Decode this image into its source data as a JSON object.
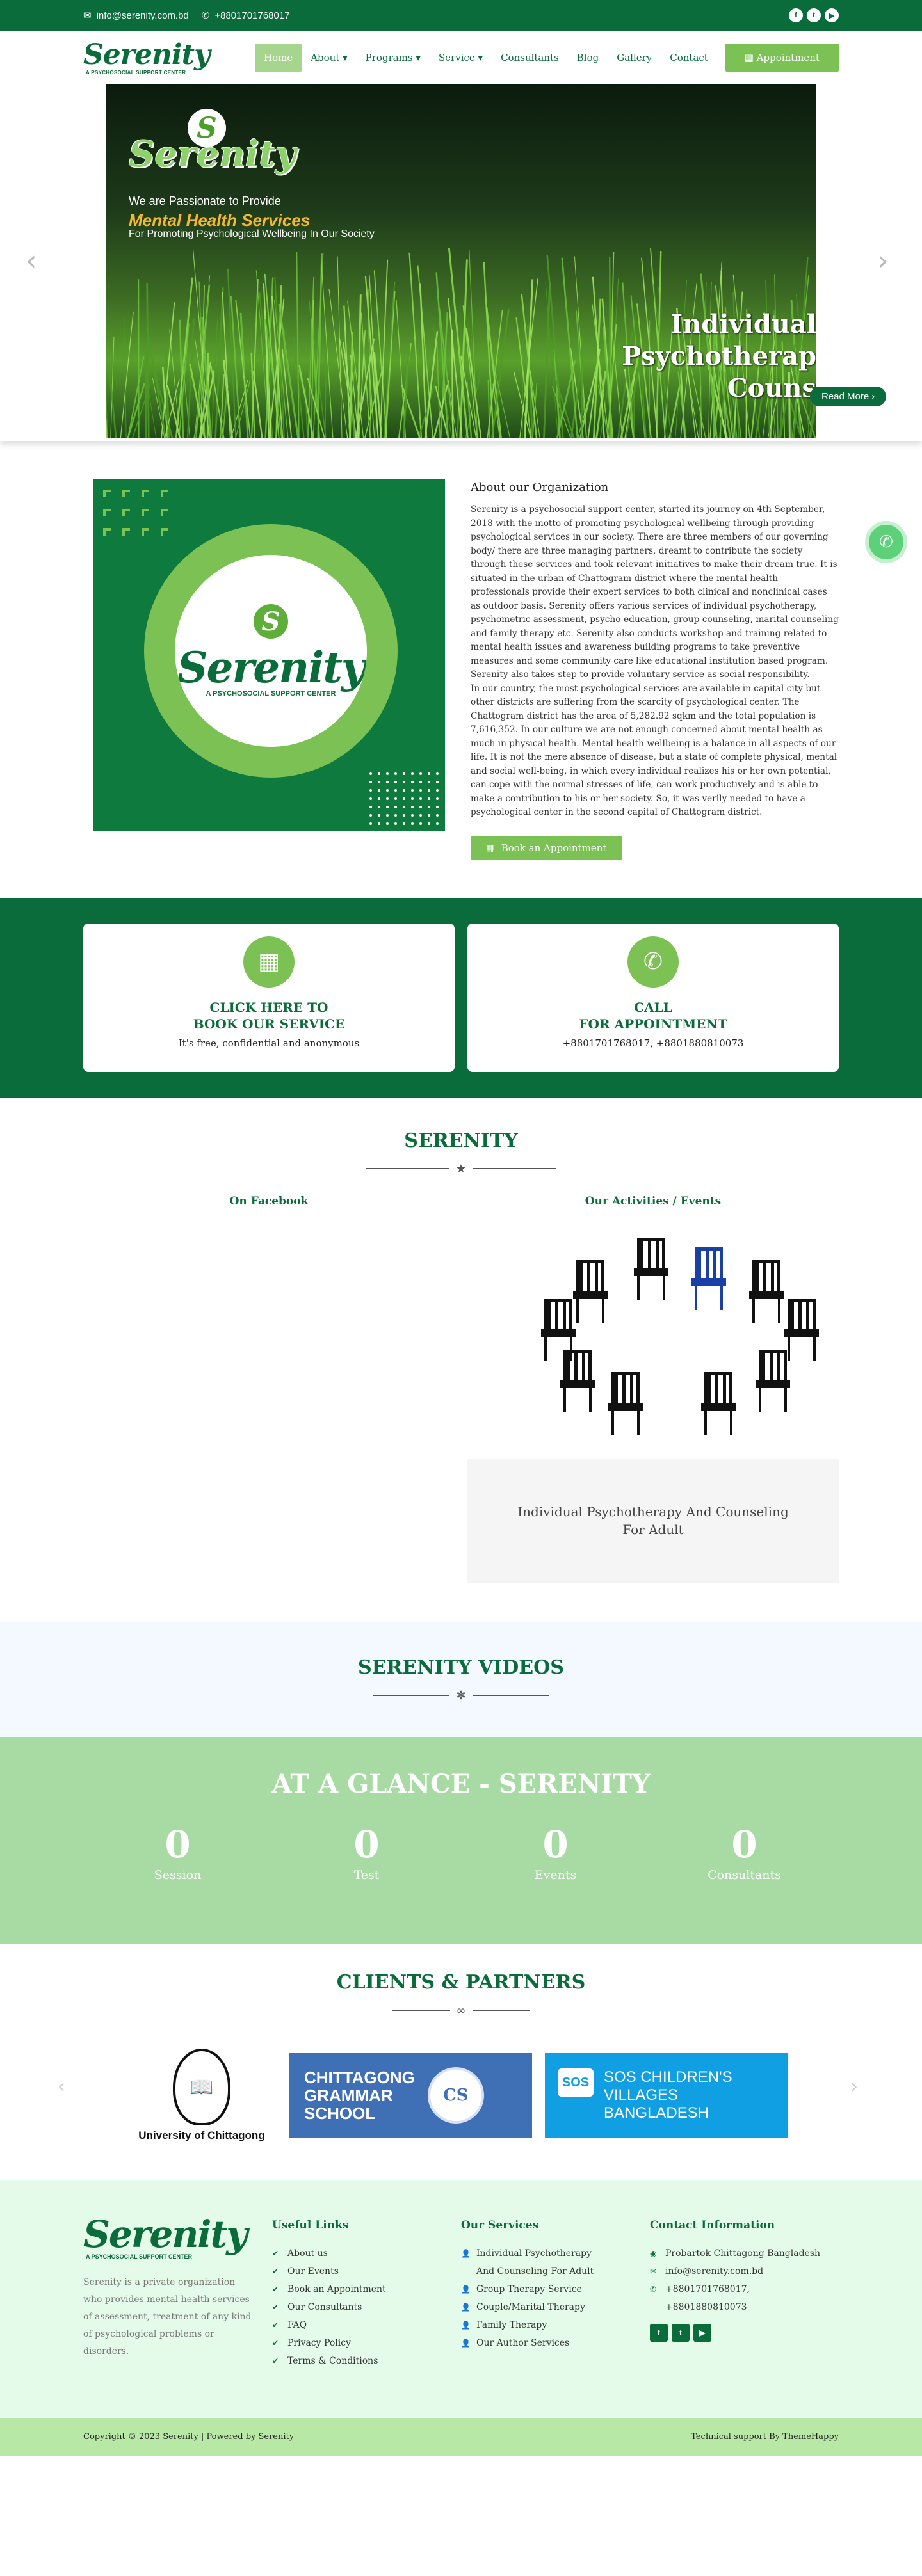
{
  "topbar": {
    "email": "info@serenity.com.bd",
    "phone": "+8801701768017",
    "social": [
      "f",
      "t",
      "▶"
    ]
  },
  "logo": {
    "word": "Serenity",
    "tagline": "A PSYCHOSOCIAL SUPPORT CENTER"
  },
  "nav": {
    "items": [
      {
        "label": "Home"
      },
      {
        "label": "About ▾"
      },
      {
        "label": "Programs ▾"
      },
      {
        "label": "Service ▾"
      },
      {
        "label": "Consultants"
      },
      {
        "label": "Blog"
      },
      {
        "label": "Gallery"
      },
      {
        "label": "Contact"
      }
    ],
    "appointment_label": "Appointment"
  },
  "hero": {
    "logo_word": "Serenity",
    "line1": "We are Passionate to Provide",
    "line2": "Mental Health Services",
    "line3": "For Promoting Psychological Wellbeing In Our Society",
    "caption": "Individual Psychotherap\nCouns",
    "read_more": "Read More  ›",
    "prev": "‹",
    "next": "›"
  },
  "about": {
    "heading": "About our Organization",
    "para1": "Serenity is a psychosocial support center, started its journey on 4th September, 2018 with the motto of promoting psychological wellbeing through providing psychological services in our society. There are three members of our governing body/ there are three managing partners, dreamt to contribute the society through these services and took relevant initiatives to make their dream true. It is situated in the urban of Chattogram district where the mental health professionals provide their expert services to both clinical and nonclinical cases as outdoor basis. Serenity offers various services of individual psychotherapy, psychometric assessment, psycho-education, group counseling, marital counseling and family therapy etc. Serenity also conducts workshop and training related to mental health issues and awareness building programs to take preventive measures and some community care like educational institution based program. Serenity also takes step to provide voluntary service as social responsibility.",
    "para2": "In our country, the most psychological services are available in capital city but other districts are suffering from the scarcity of psychological center. The Chattogram district has the area of 5,282.92 sqkm and the total population is 7,616,352. In our culture we are not enough concerned about mental health as much in physical health. Mental health wellbeing is a balance in all aspects of our life. It is not the mere absence of disease, but a state of complete physical, mental and social well-being, in which every individual realizes his or her own potential, can cope with the normal stresses of life, can work productively and is able to make a contribution to his or her society. So, it was verily needed to have a psychological center in the second capital of Chattogram district.",
    "button": "Book an Appointment",
    "image_word": "Serenity",
    "image_tag": "A PSYCHOSOCIAL SUPPORT CENTER"
  },
  "cta": [
    {
      "icon": "calendar-icon",
      "title": "CLICK HERE TO\nBOOK OUR SERVICE",
      "text": "It's free, confidential and anonymous"
    },
    {
      "icon": "phone-icon",
      "title": "CALL\nFOR APPOINTMENT",
      "text": "+8801701768017, +8801880810073"
    }
  ],
  "serenity": {
    "title": "SERENITY",
    "facebook": "On Facebook",
    "events": "Our Activities / Events",
    "event_title": "Individual Psychotherapy And Counseling For Adult"
  },
  "videos": {
    "title": "SERENITY VIDEOS"
  },
  "glance": {
    "title": "AT A GLANCE - SERENITY",
    "counters": [
      {
        "value": "0",
        "label": "Session"
      },
      {
        "value": "0",
        "label": "Test"
      },
      {
        "value": "0",
        "label": "Events"
      },
      {
        "value": "0",
        "label": "Consultants"
      }
    ]
  },
  "clients": {
    "title": "CLIENTS & PARTNERS",
    "uoc": "University of Chittagong",
    "cgs": "CHITTAGONG\nGRAMMAR\nSCHOOL",
    "cgs_badge": "CS",
    "sos": "SOS CHILDREN'S\nVILLAGES\nBANGLADESH",
    "sos_badge": "SOS"
  },
  "footer": {
    "logo": "Serenity",
    "tagline": "A PSYCHOSOCIAL SUPPORT CENTER",
    "desc": "Serenity is a private organization who provides mental health services of assessment, treatment of any kind of psychological problems or disorders.",
    "links_title": "Useful Links",
    "links": [
      "About us",
      "Our Events",
      "Book an Appointment",
      "Our Consultants",
      "FAQ",
      "Privacy Policy",
      "Terms & Conditions"
    ],
    "services_title": "Our Services",
    "services": [
      "Individual Psychotherapy And Counseling For Adult",
      "Group Therapy Service",
      "Couple/Marital Therapy",
      "Family Therapy",
      "Our Author Services"
    ],
    "contact_title": "Contact Information",
    "address": "Probartok Chittagong Bangladesh",
    "email": "info@serenity.com.bd",
    "phones": "+8801701768017,\n+8801880810073",
    "copyright": "Copyright © 2023 Serenity | Powered by Serenity",
    "support": "Technical support By ThemeHappy"
  }
}
